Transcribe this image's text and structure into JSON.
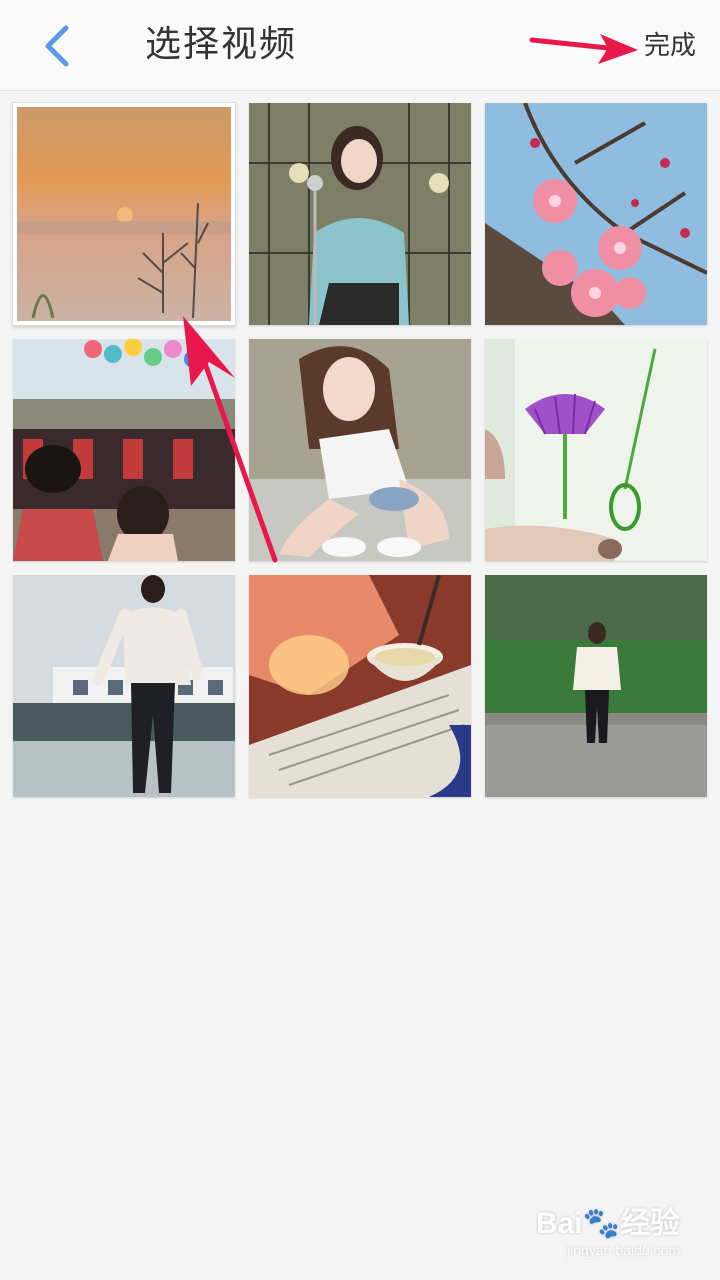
{
  "header": {
    "title": "选择视频",
    "done_label": "完成",
    "accent_color": "#5a9ae8"
  },
  "videos": [
    {
      "name": "sunset-trees",
      "selected": true
    },
    {
      "name": "girl-singing-microphone",
      "selected": false
    },
    {
      "name": "plum-blossoms",
      "selected": false
    },
    {
      "name": "festival-crowd-balloons",
      "selected": false
    },
    {
      "name": "girl-sitting-smiling",
      "selected": false
    },
    {
      "name": "purple-flower-embroidery",
      "selected": false
    },
    {
      "name": "woman-on-rooftop",
      "selected": false
    },
    {
      "name": "cooking-bowl-newspaper",
      "selected": false
    },
    {
      "name": "woman-by-hedge",
      "selected": false
    }
  ],
  "watermark": {
    "logo": "Bai🐾经验",
    "url": "jingyan.baidu.com"
  }
}
